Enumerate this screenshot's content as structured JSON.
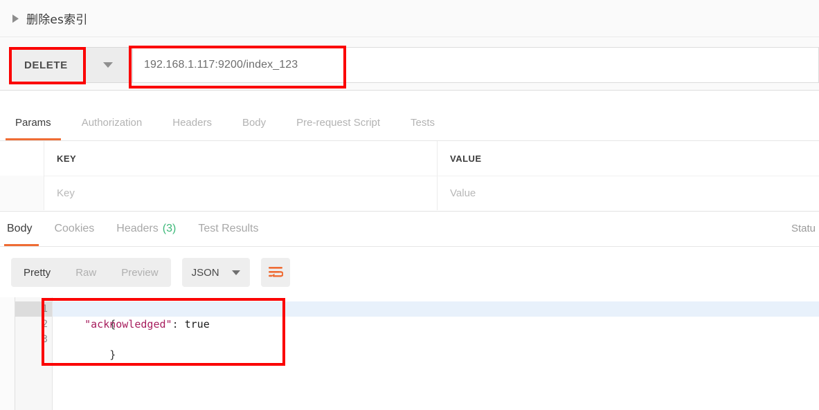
{
  "request": {
    "name": "删除es索引",
    "disclosure_icon": "triangle-right-icon",
    "method": "DELETE",
    "method_caret_icon": "chevron-down-icon",
    "url": "192.168.1.117:9200/index_123"
  },
  "request_tabs": [
    {
      "label": "Params",
      "active": true
    },
    {
      "label": "Authorization",
      "active": false
    },
    {
      "label": "Headers",
      "active": false
    },
    {
      "label": "Body",
      "active": false
    },
    {
      "label": "Pre-request Script",
      "active": false
    },
    {
      "label": "Tests",
      "active": false
    }
  ],
  "params_table": {
    "columns": [
      "KEY",
      "VALUE"
    ],
    "rows": [
      {
        "key_placeholder": "Key",
        "value_placeholder": "Value"
      }
    ]
  },
  "response_tabs": [
    {
      "label": "Body",
      "count": "",
      "active": true
    },
    {
      "label": "Cookies",
      "count": "",
      "active": false
    },
    {
      "label": "Headers",
      "count": "(3)",
      "active": false
    },
    {
      "label": "Test Results",
      "count": "",
      "active": false
    }
  ],
  "response_status_partial": "Statu",
  "body_toolbar": {
    "views": [
      {
        "label": "Pretty",
        "active": true
      },
      {
        "label": "Raw",
        "active": false
      },
      {
        "label": "Preview",
        "active": false
      }
    ],
    "format": "JSON",
    "format_caret_icon": "chevron-down-icon",
    "wrap_icon": "word-wrap-icon"
  },
  "code": {
    "lines": [
      {
        "num": "1",
        "fold": true,
        "current": true,
        "text": "{"
      },
      {
        "num": "2",
        "fold": false,
        "current": false,
        "text": "    \"acknowledged\": true"
      },
      {
        "num": "3",
        "fold": false,
        "current": false,
        "text": "}"
      }
    ],
    "line1": "{",
    "line2_indent": "    ",
    "line2_key": "\"acknowledged\"",
    "line2_colon": ": ",
    "line2_value": "true",
    "line3": "}",
    "gutter_numbers": [
      "1",
      "2",
      "3"
    ]
  },
  "colors": {
    "accent_orange": "#ef6c34",
    "annotation_red": "#fb0000",
    "count_green": "#3cb878",
    "json_key": "#a71d5d"
  }
}
